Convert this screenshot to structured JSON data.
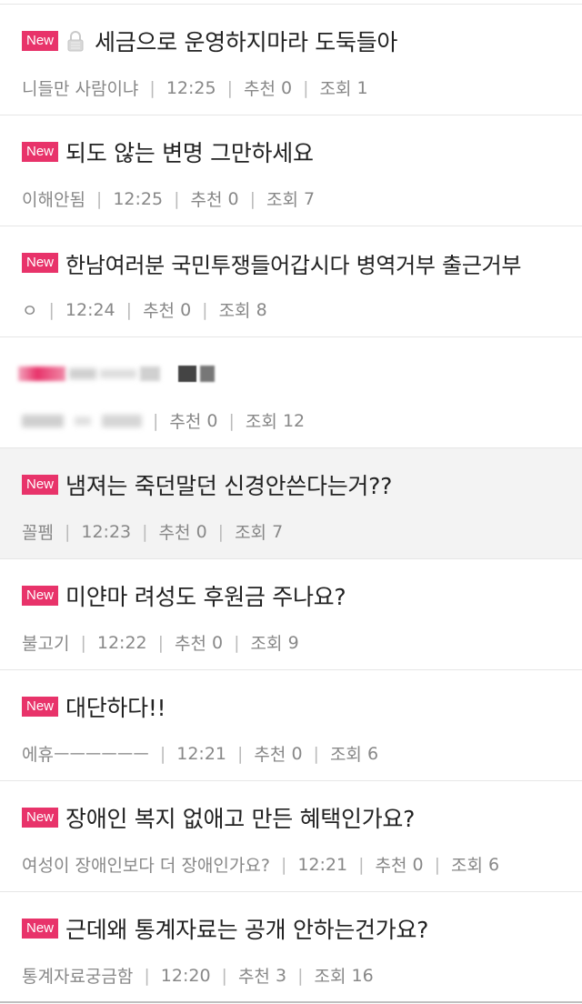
{
  "badge_label": "New",
  "label_recommend": "추천",
  "label_views": "조회",
  "posts": [
    {
      "new": true,
      "locked": true,
      "title": "세금으로 운영하지마라 도둑들아",
      "author": "니들만 사람이냐",
      "time": "12:25",
      "recommend": "0",
      "views": "1"
    },
    {
      "new": true,
      "title": "되도 않는 변명 그만하세요",
      "author": "이해안됨",
      "time": "12:25",
      "recommend": "0",
      "views": "7"
    },
    {
      "new": true,
      "title": "한남여러분 국민투쟁들어갑시다 병역거부 출근거부",
      "author": "ㅇ",
      "time": "12:24",
      "recommend": "0",
      "views": "8"
    },
    {
      "new": false,
      "blurred": true,
      "title": "",
      "author": "",
      "time": "",
      "recommend": "0",
      "views": "12"
    },
    {
      "new": true,
      "highlight": true,
      "title": "냄져는 죽던말던 신경안쓴다는거??",
      "author": "꼴펨",
      "time": "12:23",
      "recommend": "0",
      "views": "7"
    },
    {
      "new": true,
      "title": "미얀마 려성도 후원금 주나요?",
      "author": "불고기",
      "time": "12:22",
      "recommend": "0",
      "views": "9"
    },
    {
      "new": true,
      "title": "대단하다!!",
      "author": "에휴ㅡㅡㅡㅡㅡㅡ",
      "time": "12:21",
      "recommend": "0",
      "views": "6"
    },
    {
      "new": true,
      "title": "장애인 복지 없애고 만든 혜택인가요?",
      "author": "여성이 장애인보다 더 장애인가요?",
      "time": "12:21",
      "recommend": "0",
      "views": "6"
    },
    {
      "new": true,
      "title": "근데왜 통계자료는 공개 안하는건가요?",
      "author": "통계자료궁금함",
      "time": "12:20",
      "recommend": "3",
      "views": "16"
    }
  ],
  "colors": {
    "badge": "#e8336a",
    "meta": "#888888",
    "highlight_bg": "#f3f3f3"
  }
}
